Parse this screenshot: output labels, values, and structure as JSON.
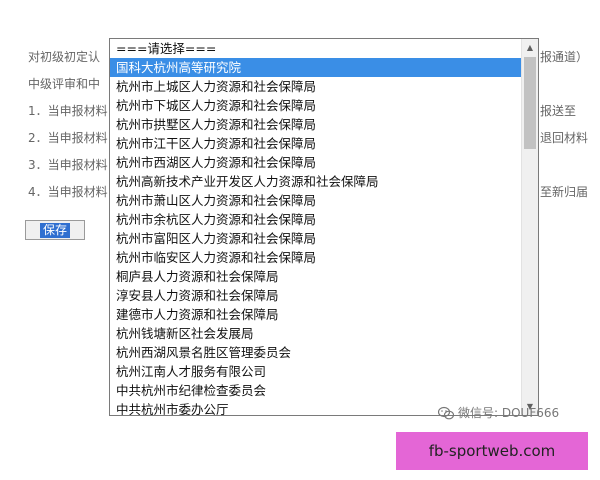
{
  "background": {
    "lines": [
      "对初级初定认",
      "中级评审和中",
      "1．当申报材料",
      "2．当申报材料",
      "3．当申报材料",
      "4．当申报材料"
    ],
    "right_fragments": [
      "报通道）",
      "报送至",
      "退回材料",
      "至新归届"
    ],
    "save_label": "保存"
  },
  "dropdown": {
    "options": [
      "===请选择===",
      "国科大杭州高等研究院",
      "杭州市上城区人力资源和社会保障局",
      "杭州市下城区人力资源和社会保障局",
      "杭州市拱墅区人力资源和社会保障局",
      "杭州市江干区人力资源和社会保障局",
      "杭州市西湖区人力资源和社会保障局",
      "杭州高新技术产业开发区人力资源和社会保障局",
      "杭州市萧山区人力资源和社会保障局",
      "杭州市余杭区人力资源和社会保障局",
      "杭州市富阳区人力资源和社会保障局",
      "杭州市临安区人力资源和社会保障局",
      "桐庐县人力资源和社会保障局",
      "淳安县人力资源和社会保障局",
      "建德市人力资源和社会保障局",
      "杭州钱塘新区社会发展局",
      "杭州西湖风景名胜区管理委员会",
      "杭州江南人才服务有限公司",
      "中共杭州市纪律检查委员会",
      "中共杭州市委办公厅"
    ],
    "selected_index": 1,
    "scroll_up_icon": "triangle-up",
    "scroll_down_icon": "triangle-down"
  },
  "watermark": {
    "text": "微信号: DOUF666",
    "icon": "wechat-icon"
  },
  "banner": {
    "text": "fb-sportweb.com"
  },
  "colors": {
    "selected_bg": "#3a8ee6",
    "banner_bg": "#e466d6",
    "save_bg": "#2f6fd0"
  }
}
